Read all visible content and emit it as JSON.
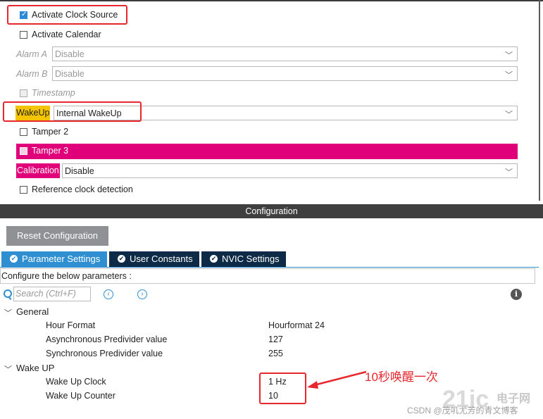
{
  "pin_panel": {
    "activate_clock_source": {
      "label": "Activate Clock Source",
      "checked": true
    },
    "activate_calendar": {
      "label": "Activate Calendar",
      "checked": false
    },
    "alarm_a": {
      "label": "Alarm A",
      "value": "Disable"
    },
    "alarm_b": {
      "label": "Alarm B",
      "value": "Disable"
    },
    "timestamp": {
      "label": "Timestamp",
      "checked": false
    },
    "wakeup": {
      "label": "WakeUp",
      "value": "Internal WakeUp"
    },
    "tamper2": {
      "label": "Tamper 2",
      "checked": false
    },
    "tamper3": {
      "label": "Tamper 3",
      "checked": false
    },
    "calibration": {
      "label": "Calibration",
      "value": "Disable"
    },
    "reference_clock": {
      "label": "Reference clock detection",
      "checked": false
    }
  },
  "configuration": {
    "title": "Configuration",
    "reset_button": "Reset Configuration",
    "tabs": [
      {
        "label": "Parameter Settings",
        "active": true
      },
      {
        "label": "User Constants",
        "active": false
      },
      {
        "label": "NVIC Settings",
        "active": false
      }
    ],
    "configure_text": "Configure the below parameters :",
    "search_placeholder": "Search (Ctrl+F)",
    "groups": [
      {
        "name": "General",
        "params": [
          {
            "name": "Hour Format",
            "value": "Hourformat 24"
          },
          {
            "name": "Asynchronous Predivider value",
            "value": "127"
          },
          {
            "name": "Synchronous Predivider value",
            "value": "255"
          }
        ]
      },
      {
        "name": "Wake UP",
        "params": [
          {
            "name": "Wake Up Clock",
            "value": "1 Hz"
          },
          {
            "name": "Wake Up Counter",
            "value": "10"
          }
        ]
      }
    ]
  },
  "annotation": {
    "text": "10秒唤醒一次"
  },
  "watermark": {
    "text": "CSDN @茂叽尤芳的青文博客",
    "logo": "电子网"
  },
  "colors": {
    "highlight_yellow": "#f5c400",
    "highlight_magenta": "#e0007a",
    "annotation_red": "#e8262d",
    "tab_active": "#2f8fd0",
    "tab_inactive": "#0d2a47"
  },
  "icons": {
    "chevron": "chevron-down-icon",
    "tree_open": "expand-arrow-icon",
    "tab_check": "check-circle-icon",
    "info": "info-icon",
    "search": "search-icon"
  }
}
